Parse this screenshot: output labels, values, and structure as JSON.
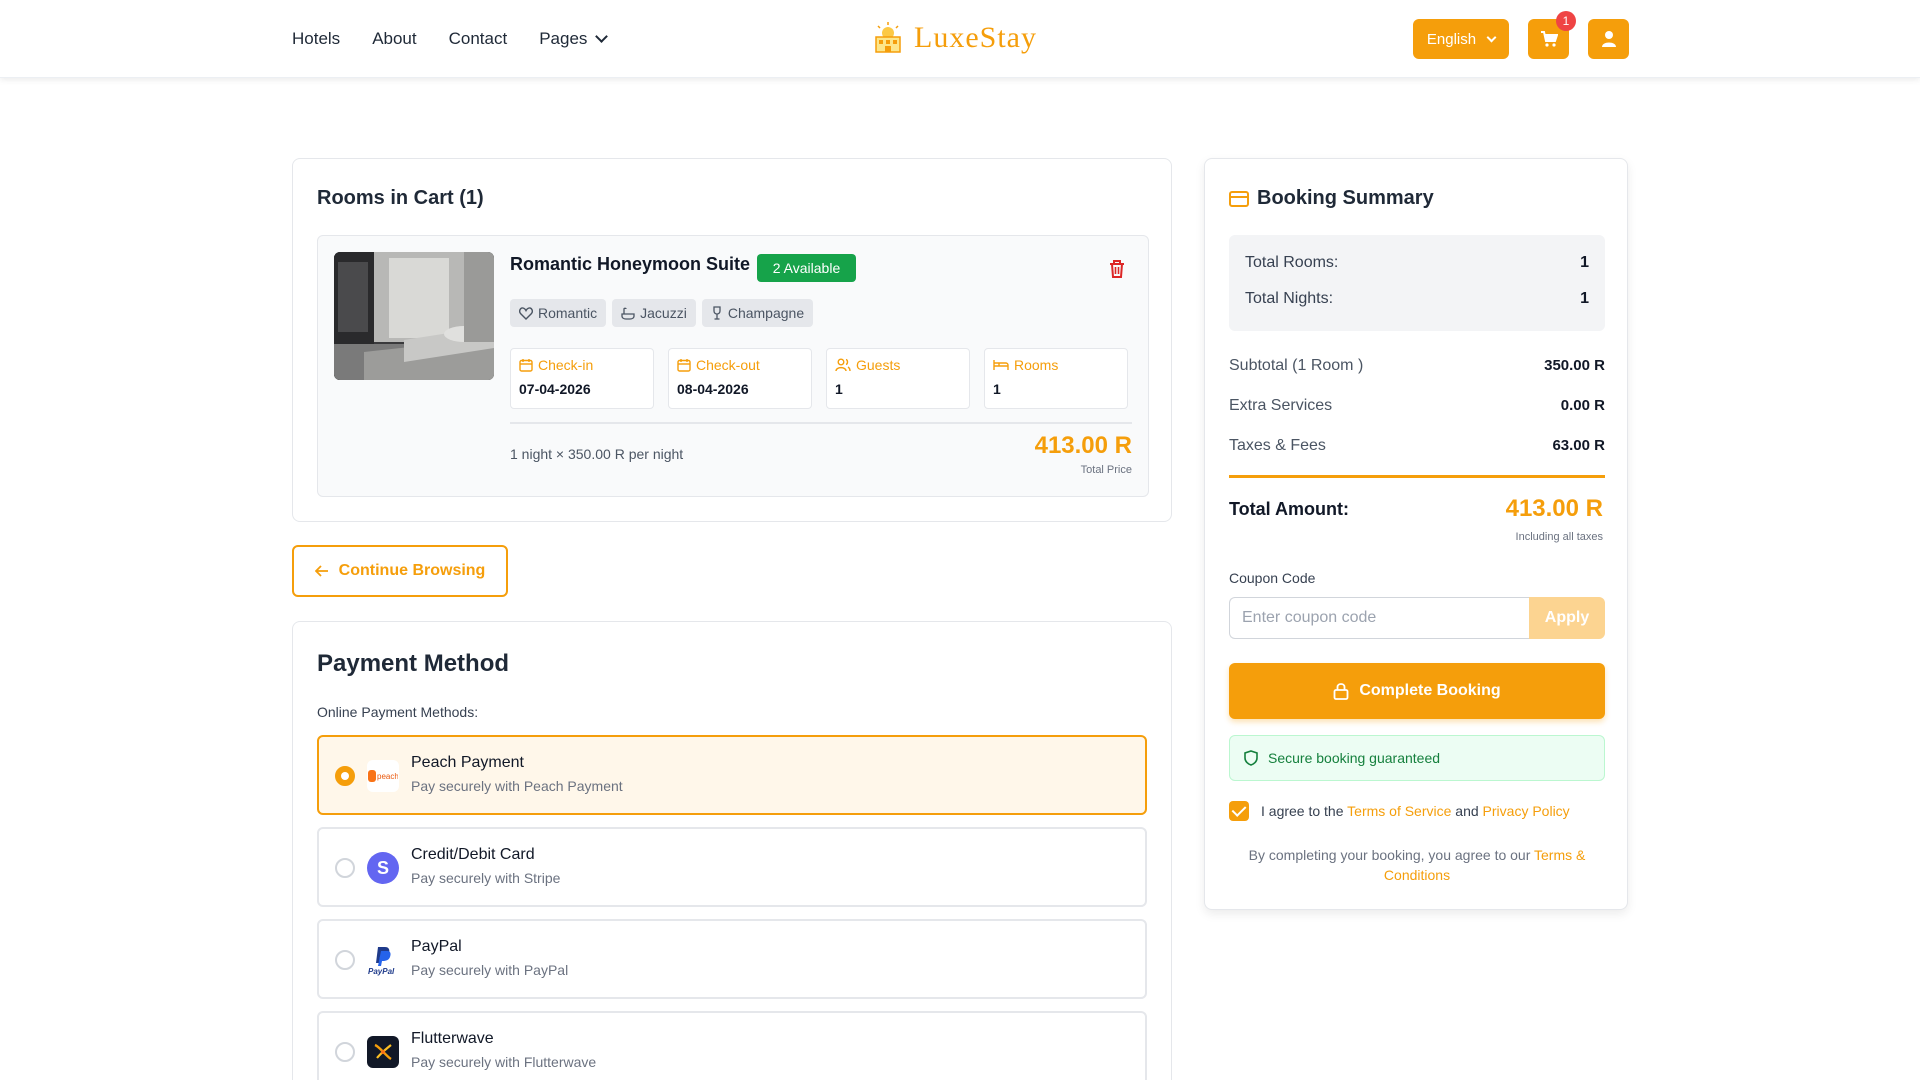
{
  "nav": {
    "links": [
      "Hotels",
      "About",
      "Contact",
      "Pages"
    ],
    "logo": "LuxeStay",
    "language": "English",
    "cart_count": "1"
  },
  "cart": {
    "title": "Rooms in Cart (1)",
    "room": {
      "name": "Romantic Honeymoon Suite",
      "availability": "2 Available",
      "tags": [
        "Romantic",
        "Jacuzzi",
        "Champagne"
      ],
      "checkin_label": "Check-in",
      "checkin": "07-04-2026",
      "checkout_label": "Check-out",
      "checkout": "08-04-2026",
      "guests_label": "Guests",
      "guests": "1",
      "rooms_label": "Rooms",
      "rooms": "1",
      "per_night": "1 night × 350.00 R per night",
      "total": "413.00 R",
      "total_label": "Total Price"
    },
    "continue_label": "Continue Browsing"
  },
  "payment": {
    "title": "Payment Method",
    "subtitle": "Online Payment Methods:",
    "options": [
      {
        "name": "Peach Payment",
        "desc": "Pay securely with Peach Payment",
        "selected": true,
        "logo_text": "peach"
      },
      {
        "name": "Credit/Debit Card",
        "desc": "Pay securely with Stripe",
        "selected": false,
        "logo_text": "S"
      },
      {
        "name": "PayPal",
        "desc": "Pay securely with PayPal",
        "selected": false,
        "logo_text": "PayPal"
      },
      {
        "name": "Flutterwave",
        "desc": "Pay securely with Flutterwave",
        "selected": false,
        "logo_text": ""
      }
    ]
  },
  "summary": {
    "title": "Booking Summary",
    "total_rooms_label": "Total Rooms:",
    "total_rooms": "1",
    "total_nights_label": "Total Nights:",
    "total_nights": "1",
    "subtotal_label": "Subtotal (1 Room )",
    "subtotal": "350.00 R",
    "extras_label": "Extra Services",
    "extras": "0.00 R",
    "taxes_label": "Taxes & Fees",
    "taxes": "63.00 R",
    "total_label": "Total Amount:",
    "total": "413.00 R",
    "total_note": "Including all taxes",
    "coupon_label": "Coupon Code",
    "coupon_placeholder": "Enter coupon code",
    "apply_label": "Apply",
    "complete_label": "Complete Booking",
    "secure_text": "Secure booking guaranteed",
    "agree_prefix": "I agree to the",
    "terms_link": "Terms of Service",
    "agree_and": "and",
    "privacy_link": "Privacy Policy",
    "footnote": "By completing your booking, you agree to our",
    "footnote_link": "Terms & Conditions"
  },
  "colors": {
    "accent": "#f59e0b",
    "success": "#16a34a",
    "danger": "#ef4444"
  }
}
